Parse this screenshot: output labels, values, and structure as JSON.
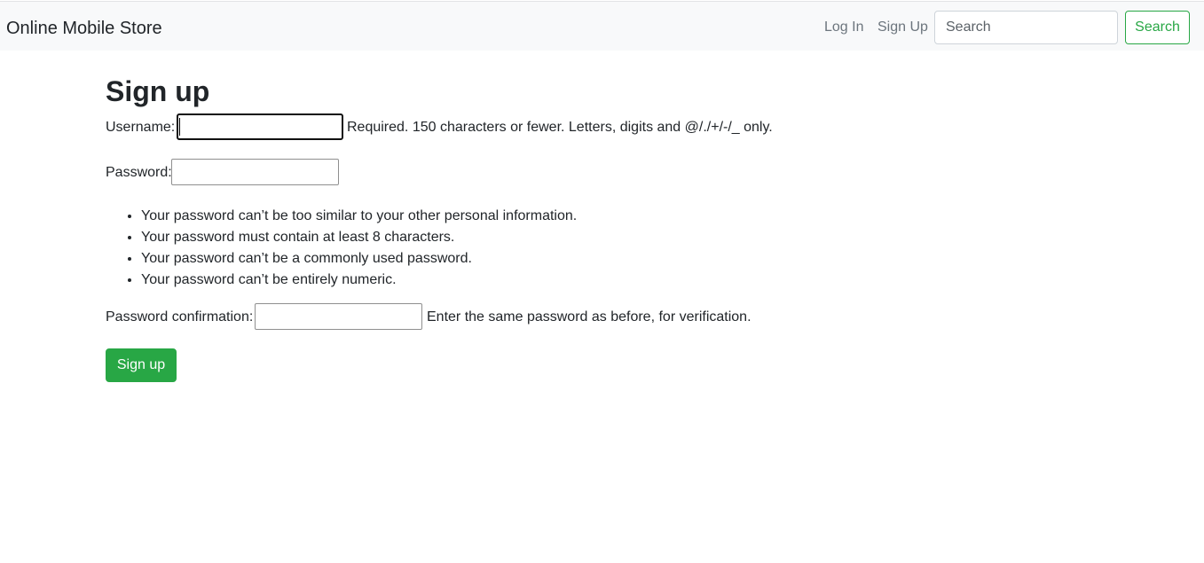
{
  "navbar": {
    "brand": "Online Mobile Store",
    "links": [
      {
        "label": "Log In"
      },
      {
        "label": "Sign Up"
      }
    ],
    "search": {
      "placeholder": "Search",
      "value": "",
      "button_label": "Search"
    },
    "colors": {
      "background": "#f8f9fa",
      "accent": "#28a745"
    }
  },
  "form": {
    "title": "Sign up",
    "username": {
      "label": "Username:",
      "value": "",
      "help": "Required. 150 characters or fewer. Letters, digits and @/./+/-/_ only."
    },
    "password": {
      "label": "Password:",
      "value": "",
      "hints": [
        "Your password can’t be too similar to your other personal information.",
        "Your password must contain at least 8 characters.",
        "Your password can’t be a commonly used password.",
        "Your password can’t be entirely numeric."
      ]
    },
    "password_confirmation": {
      "label": "Password confirmation:",
      "value": "",
      "help": "Enter the same password as before, for verification."
    },
    "submit_label": "Sign up",
    "submit_color": "#28a745"
  }
}
